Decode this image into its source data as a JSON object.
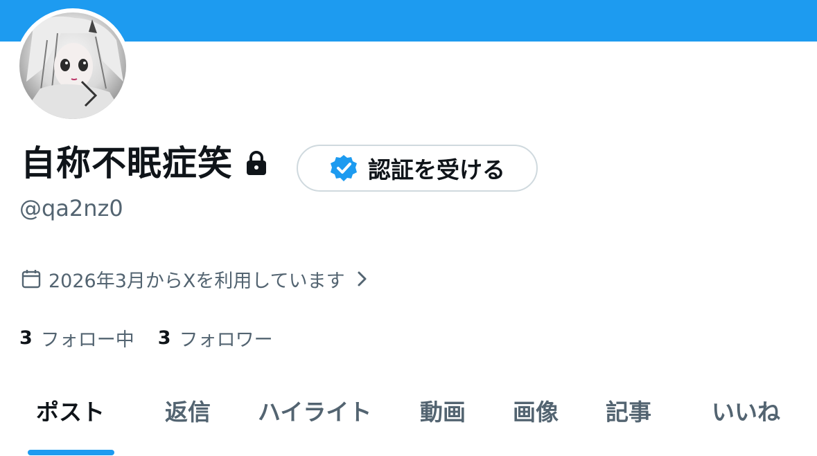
{
  "colors": {
    "accent": "#1d9bf0",
    "text_primary": "#0f1419",
    "text_secondary": "#536471",
    "border": "#cfd9de"
  },
  "profile": {
    "display_name": "自称不眠症笑",
    "lock_icon": "lock-icon",
    "handle": "@qa2nz0",
    "verify_button": {
      "icon": "verified-badge-icon",
      "label": "認証を受ける"
    },
    "joined": {
      "icon": "calendar-icon",
      "text": "2026年3月からXを利用しています",
      "chevron": "chevron-right-icon"
    }
  },
  "stats": {
    "following": {
      "count": "3",
      "label": "フォロー中"
    },
    "followers": {
      "count": "3",
      "label": "フォロワー"
    }
  },
  "tabs": [
    {
      "label": "ポスト",
      "active": true
    },
    {
      "label": "返信",
      "active": false
    },
    {
      "label": "ハイライト",
      "active": false
    },
    {
      "label": "動画",
      "active": false
    },
    {
      "label": "画像",
      "active": false
    },
    {
      "label": "記事",
      "active": false
    },
    {
      "label": "いいね",
      "active": false
    }
  ]
}
